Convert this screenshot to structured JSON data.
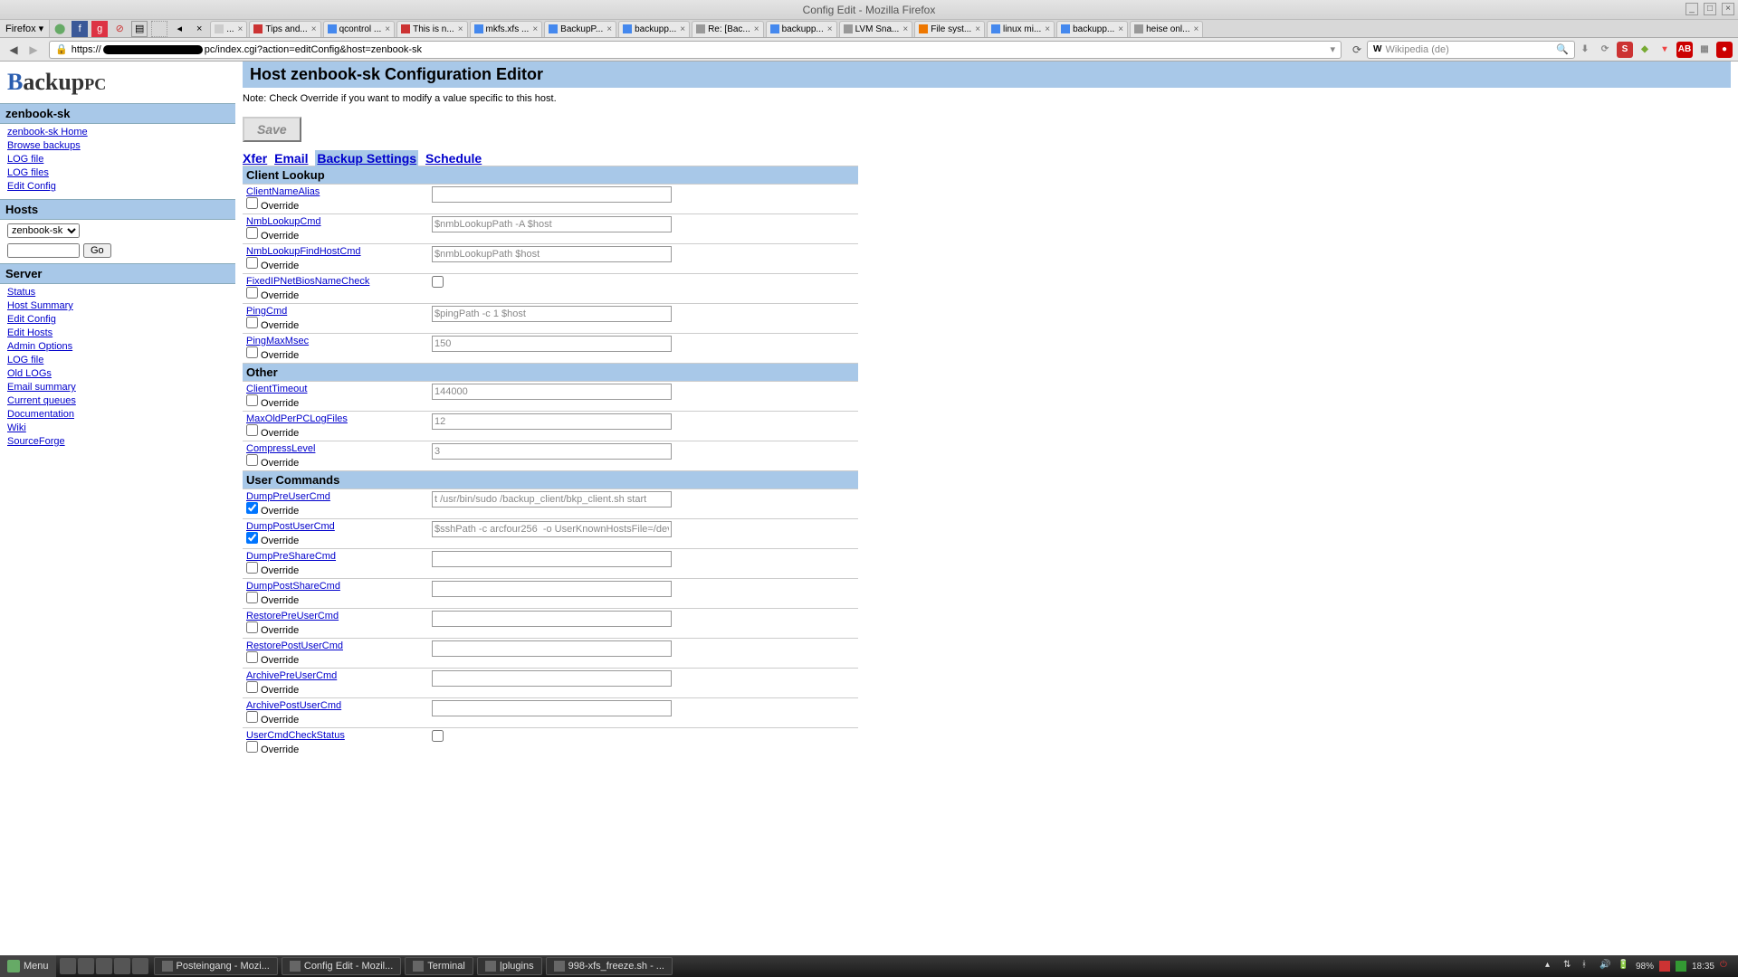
{
  "window": {
    "title": "Config Edit - Mozilla Firefox"
  },
  "firefox": {
    "menu": "Firefox ▾",
    "tabs": [
      {
        "label": "...",
        "fav": "#ccc"
      },
      {
        "label": "Tips and...",
        "fav": "#c33"
      },
      {
        "label": "qcontrol ...",
        "fav": "#48e"
      },
      {
        "label": "This is n...",
        "fav": "#c33"
      },
      {
        "label": "mkfs.xfs ...",
        "fav": "#48e"
      },
      {
        "label": "BackupP...",
        "fav": "#48e"
      },
      {
        "label": "backupp...",
        "fav": "#48e"
      },
      {
        "label": "Re: [Bac...",
        "fav": "#999"
      },
      {
        "label": "backupp...",
        "fav": "#48e"
      },
      {
        "label": "LVM Sna...",
        "fav": "#999"
      },
      {
        "label": "File syst...",
        "fav": "#e70"
      },
      {
        "label": "linux mi...",
        "fav": "#48e"
      },
      {
        "label": "backupp...",
        "fav": "#48e"
      },
      {
        "label": "heise onl...",
        "fav": "#999"
      }
    ],
    "url_prefix": "https://",
    "url_suffix": "pc/index.cgi?action=editConfig&host=zenbook-sk",
    "search_prov": "W",
    "search_placeholder": "Wikipedia (de)"
  },
  "logo": {
    "part1": "Backup",
    "part2": "PC"
  },
  "sidebar": {
    "host_header": "zenbook-sk",
    "host_links": [
      "zenbook-sk Home",
      "Browse backups",
      "LOG file",
      "LOG files",
      "Edit Config"
    ],
    "hosts_header": "Hosts",
    "select_value": "zenbook-sk",
    "go": "Go",
    "server_header": "Server",
    "server_links": [
      "Status",
      "Host Summary",
      "Edit Config",
      "Edit Hosts",
      "Admin Options",
      "LOG file",
      "Old LOGs",
      "Email summary",
      "Current queues",
      "Documentation",
      "Wiki",
      "SourceForge"
    ]
  },
  "main": {
    "title": "Host zenbook-sk Configuration Editor",
    "note": "Note: Check Override if you want to modify a value specific to this host.",
    "save": "Save",
    "tabs": {
      "xfer": "Xfer",
      "email": "Email",
      "backup": "Backup Settings",
      "schedule": "Schedule"
    },
    "override": "Override"
  },
  "sections": {
    "client_lookup": "Client Lookup",
    "other": "Other",
    "user_commands": "User Commands"
  },
  "rows": {
    "ClientNameAlias": {
      "v": ""
    },
    "NmbLookupCmd": {
      "v": "$nmbLookupPath -A $host"
    },
    "NmbLookupFindHostCmd": {
      "v": "$nmbLookupPath $host"
    },
    "FixedIPNetBiosNameCheck": {
      "type": "check"
    },
    "PingCmd": {
      "v": "$pingPath -c 1 $host"
    },
    "PingMaxMsec": {
      "v": "150"
    },
    "ClientTimeout": {
      "v": "144000"
    },
    "MaxOldPerPCLogFiles": {
      "v": "12"
    },
    "CompressLevel": {
      "v": "3"
    },
    "DumpPreUserCmd": {
      "v": "t /usr/bin/sudo /backup_client/bkp_client.sh start",
      "checked": true
    },
    "DumpPostUserCmd": {
      "v": "$sshPath -c arcfour256  -o UserKnownHostsFile=/dev",
      "checked": true
    },
    "DumpPreShareCmd": {
      "v": ""
    },
    "DumpPostShareCmd": {
      "v": ""
    },
    "RestorePreUserCmd": {
      "v": ""
    },
    "RestorePostUserCmd": {
      "v": ""
    },
    "ArchivePreUserCmd": {
      "v": ""
    },
    "ArchivePostUserCmd": {
      "v": ""
    },
    "UserCmdCheckStatus": {
      "type": "check"
    }
  },
  "taskbar": {
    "menu": "Menu",
    "tasks": [
      "Posteingang - Mozi...",
      "Config Edit - Mozil...",
      "Terminal",
      "|plugins",
      "998-xfs_freeze.sh - ..."
    ],
    "battery": "98%",
    "time": "18:35"
  }
}
